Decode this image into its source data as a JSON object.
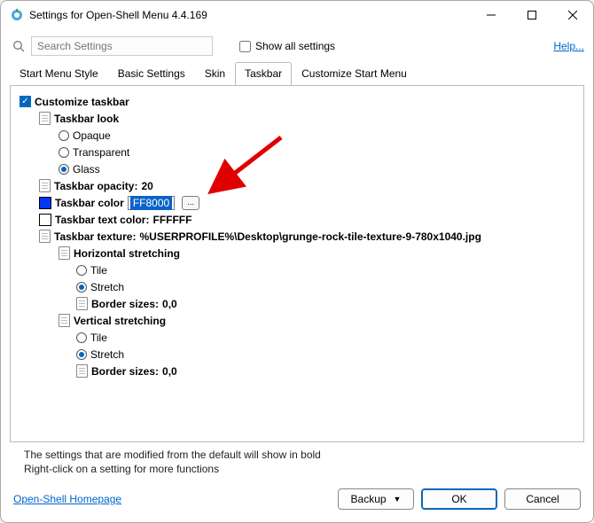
{
  "window": {
    "title": "Settings for Open-Shell Menu 4.4.169"
  },
  "toolbar": {
    "search_placeholder": "Search Settings",
    "show_all_label": "Show all settings",
    "help_label": "Help..."
  },
  "tabs": [
    {
      "label": "Start Menu Style",
      "active": false
    },
    {
      "label": "Basic Settings",
      "active": false
    },
    {
      "label": "Skin",
      "active": false
    },
    {
      "label": "Taskbar",
      "active": true
    },
    {
      "label": "Customize Start Menu",
      "active": false
    }
  ],
  "tree": {
    "customize_taskbar": {
      "label": "Customize taskbar",
      "checked": true
    },
    "taskbar_look": {
      "label": "Taskbar look"
    },
    "look_options": [
      {
        "label": "Opaque",
        "selected": false
      },
      {
        "label": "Transparent",
        "selected": false
      },
      {
        "label": "Glass",
        "selected": true
      }
    ],
    "opacity": {
      "label": "Taskbar opacity:",
      "value": "20"
    },
    "color": {
      "label": "Taskbar color",
      "value": "FF8000",
      "swatch": "#0037ff"
    },
    "text_color": {
      "label": "Taskbar text color:",
      "value": "FFFFFF",
      "swatch": "#ffffff"
    },
    "texture": {
      "label": "Taskbar texture:",
      "value": "%USERPROFILE%\\Desktop\\grunge-rock-tile-texture-9-780x1040.jpg"
    },
    "h_stretch": {
      "label": "Horizontal stretching"
    },
    "h_options": [
      {
        "label": "Tile",
        "selected": false
      },
      {
        "label": "Stretch",
        "selected": true
      }
    ],
    "h_border": {
      "label": "Border sizes:",
      "value": "0,0"
    },
    "v_stretch": {
      "label": "Vertical stretching"
    },
    "v_options": [
      {
        "label": "Tile",
        "selected": false
      },
      {
        "label": "Stretch",
        "selected": true
      }
    ],
    "v_border": {
      "label": "Border sizes:",
      "value": "0,0"
    }
  },
  "info": {
    "line1": "The settings that are modified from the default will show in bold",
    "line2": "Right-click on a setting for more functions"
  },
  "footer": {
    "homepage": "Open-Shell Homepage",
    "backup": "Backup",
    "ok": "OK",
    "cancel": "Cancel"
  }
}
